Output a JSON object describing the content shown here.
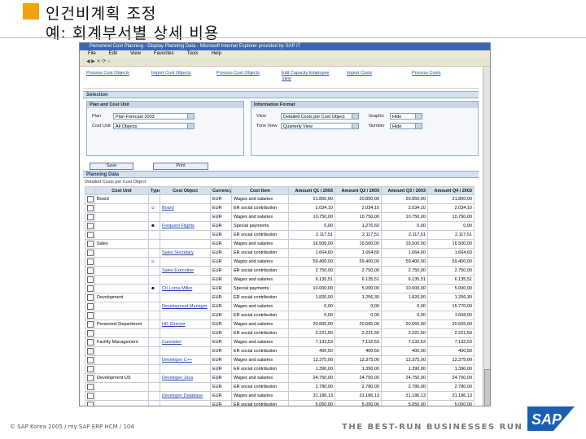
{
  "slide": {
    "title_line1": "인건비계획 조정",
    "title_line2": "예: 회계부서별 상세 비용",
    "footer_copyright": "© SAP Korea 2005 / my SAP ERP HCM / 104",
    "footer_tagline": "THE BEST-RUN BUSINESSES RUN SAP",
    "logo_text": "SAP",
    "colors": {
      "accent": "#f0a30a",
      "sap_blue": "#1a5fb4"
    }
  },
  "window": {
    "title": "Personnel Cost Planning - Display Planning Data - Microsoft Internet Explorer provided by SAP IT",
    "menu": [
      "File",
      "Edit",
      "View",
      "Favorites",
      "Tools",
      "Help"
    ]
  },
  "nav_links": [
    "Process Cost Objects",
    "Import Cost Objects",
    "Process Cost Objects",
    "Edit Capacity Employee View",
    "Import Costs",
    "Process Costs"
  ],
  "selection": {
    "header": "Selection",
    "plan_panel": {
      "header": "Plan and Cost Unit",
      "plan_label": "Plan",
      "plan_value": "Plan Forecast 2003",
      "unit_label": "Cost Unit",
      "unit_value": "All Objects"
    },
    "info_panel": {
      "header": "Information Format",
      "view_label": "View",
      "view_value": "Detailed Costs per Cost Object",
      "graphic_label": "Graphic",
      "graphic_value": "Hide",
      "time_label": "Time View",
      "time_value": "Quarterly View",
      "number_label": "Number",
      "number_value": "Hide"
    },
    "buttons": {
      "save": "Save",
      "print": "Print"
    }
  },
  "planning": {
    "header": "Planning Data",
    "subheader": "Detailed Costs per Cost Object",
    "columns": [
      "",
      "Cost Unit",
      "Type",
      "Cost Object",
      "Currency",
      "Cost Item",
      "Amount Q1 / 2003",
      "Amount Q2 / 2003",
      "Amount Q3 / 2003",
      "Amount Q4 / 2003"
    ],
    "rows": [
      {
        "unit": "Board",
        "type": "",
        "object": "",
        "cur": "EUR",
        "item": "Wages and salaries",
        "q1": "21.850,00",
        "q2": "20.850,00",
        "q3": "20.850,00",
        "q4": "21.850,00"
      },
      {
        "unit": "",
        "type": "person",
        "object": "Board",
        "cur": "EUR",
        "item": "ER social contribution",
        "q1": "2.034,10",
        "q2": "2.034,10",
        "q3": "2.034,10",
        "q4": "2.034,10"
      },
      {
        "unit": "",
        "type": "",
        "object": "",
        "cur": "EUR",
        "item": "Wages and salaries",
        "q1": "10.750,00",
        "q2": "10.750,00",
        "q3": "10.750,00",
        "q4": "10.750,00"
      },
      {
        "unit": "",
        "type": "group",
        "object": "Frequent Flights",
        "cur": "EUR",
        "item": "Special payments",
        "q1": "0,00",
        "q2": "1.276,60",
        "q3": "0,00",
        "q4": "0,00"
      },
      {
        "unit": "",
        "type": "",
        "object": "",
        "cur": "EUR",
        "item": "ER social contribution",
        "q1": "2.117,51",
        "q2": "2.117,51",
        "q3": "2.117,51",
        "q4": "2.117,51"
      },
      {
        "unit": "Sales",
        "type": "",
        "object": "",
        "cur": "EUR",
        "item": "Wages and salaries",
        "q1": "16.500,00",
        "q2": "16.500,00",
        "q3": "16.500,00",
        "q4": "16.500,00"
      },
      {
        "unit": "",
        "type": "",
        "object": "Sales Secretary",
        "cur": "EUR",
        "item": "ER social contribution",
        "q1": "1.664,60",
        "q2": "1.664,60",
        "q3": "1.664,60",
        "q4": "1.664,60"
      },
      {
        "unit": "",
        "type": "person",
        "object": "",
        "cur": "EUR",
        "item": "Wages and salaries",
        "q1": "59.400,00",
        "q2": "59.400,00",
        "q3": "59.400,00",
        "q4": "59.400,00"
      },
      {
        "unit": "",
        "type": "",
        "object": "Sales Executive",
        "cur": "EUR",
        "item": "ER social contribution",
        "q1": "2.750,00",
        "q2": "2.750,00",
        "q3": "2.750,00",
        "q4": "2.750,00"
      },
      {
        "unit": "",
        "type": "",
        "object": "",
        "cur": "EUR",
        "item": "Wages and salaries",
        "q1": "6.135,51",
        "q2": "6.135,51",
        "q3": "6.135,51",
        "q4": "6.135,51"
      },
      {
        "unit": "",
        "type": "group",
        "object": "Cri Lorna Miller",
        "cur": "EUR",
        "item": "Special payments",
        "q1": "10.000,00",
        "q2": "5.000,00",
        "q3": "10.000,00",
        "q4": "5.000,00"
      },
      {
        "unit": "Development",
        "type": "",
        "object": "",
        "cur": "EUR",
        "item": "ER social contribution",
        "q1": "1.820,00",
        "q2": "1.256,30",
        "q3": "1.820,00",
        "q4": "1.256,30"
      },
      {
        "unit": "",
        "type": "",
        "object": "Development Manager",
        "cur": "EUR",
        "item": "Wages and salaries",
        "q1": "0,00",
        "q2": "0,00",
        "q3": "0,00",
        "q4": "15.770,00"
      },
      {
        "unit": "",
        "type": "",
        "object": "",
        "cur": "EUR",
        "item": "ER social contribution",
        "q1": "0,00",
        "q2": "0,00",
        "q3": "0,00",
        "q4": "1.668,00"
      },
      {
        "unit": "Personnel Department",
        "type": "",
        "object": "HR Director",
        "cur": "EUR",
        "item": "Wages and salaries",
        "q1": "20.665,00",
        "q2": "20.665,00",
        "q3": "20.665,00",
        "q4": "20.665,00"
      },
      {
        "unit": "",
        "type": "",
        "object": "",
        "cur": "EUR",
        "item": "ER social contribution",
        "q1": "2.221,50",
        "q2": "2.221,50",
        "q3": "2.221,50",
        "q4": "2.221,50"
      },
      {
        "unit": "Facility Management",
        "type": "",
        "object": "Caretaker",
        "cur": "EUR",
        "item": "Wages and salaries",
        "q1": "7.132,53",
        "q2": "7.132,53",
        "q3": "7.132,53",
        "q4": "7.132,53"
      },
      {
        "unit": "",
        "type": "",
        "object": "",
        "cur": "EUR",
        "item": "ER social contribution",
        "q1": "400,50",
        "q2": "400,50",
        "q3": "400,50",
        "q4": "400,50"
      },
      {
        "unit": "",
        "type": "",
        "object": "Developer C++",
        "cur": "EUR",
        "item": "Wages and salaries",
        "q1": "12.375,00",
        "q2": "12.375,00",
        "q3": "12.375,00",
        "q4": "12.375,00"
      },
      {
        "unit": "",
        "type": "",
        "object": "",
        "cur": "EUR",
        "item": "ER social contribution",
        "q1": "1.390,00",
        "q2": "1.390,00",
        "q3": "1.390,00",
        "q4": "1.390,00"
      },
      {
        "unit": "Development US",
        "type": "",
        "object": "Developer Java",
        "cur": "EUR",
        "item": "Wages and salaries",
        "q1": "24.750,00",
        "q2": "24.750,00",
        "q3": "24.750,00",
        "q4": "24.750,00"
      },
      {
        "unit": "",
        "type": "",
        "object": "",
        "cur": "EUR",
        "item": "ER social contribution",
        "q1": "2.780,00",
        "q2": "2.780,00",
        "q3": "2.780,00",
        "q4": "2.780,00"
      },
      {
        "unit": "",
        "type": "",
        "object": "Developer Database",
        "cur": "EUR",
        "item": "Wages and salaries",
        "q1": "31.186,13",
        "q2": "31.186,13",
        "q3": "31.186,13",
        "q4": "31.186,13"
      },
      {
        "unit": "",
        "type": "",
        "object": "",
        "cur": "EUR",
        "item": "ER social contribution",
        "q1": "5.050,00",
        "q2": "5.050,00",
        "q3": "5.050,00",
        "q4": "5.050,00"
      }
    ]
  }
}
